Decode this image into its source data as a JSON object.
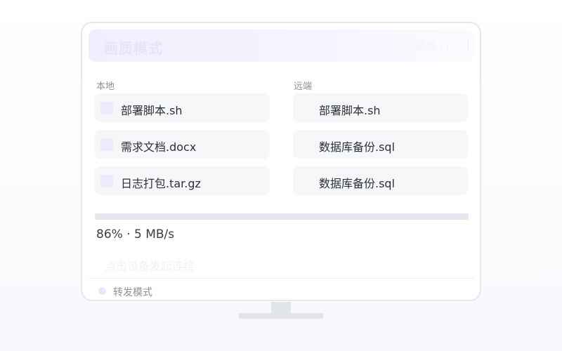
{
  "window": {
    "title": "画质模式",
    "title_right": "画质  |  |"
  },
  "local": {
    "heading": "本地",
    "files": [
      {
        "name": "部署脚本.sh"
      },
      {
        "name": "需求文档.docx"
      },
      {
        "name": "日志打包.tar.gz"
      }
    ]
  },
  "remote": {
    "heading": "远端",
    "files": [
      {
        "name": "部署脚本.sh"
      },
      {
        "name": "数据库备份.sql"
      },
      {
        "name": "数据库备份.sql"
      }
    ]
  },
  "transfer": {
    "progress": 0.86,
    "status": "86% · 5 MB/s",
    "hint": "点击设备发起连接"
  },
  "footer": {
    "mode_label": "转发模式"
  },
  "colors": {
    "accent_light": "#efe9fd",
    "card_bg": "#f6f7f9",
    "track": "#e4e8ee"
  }
}
